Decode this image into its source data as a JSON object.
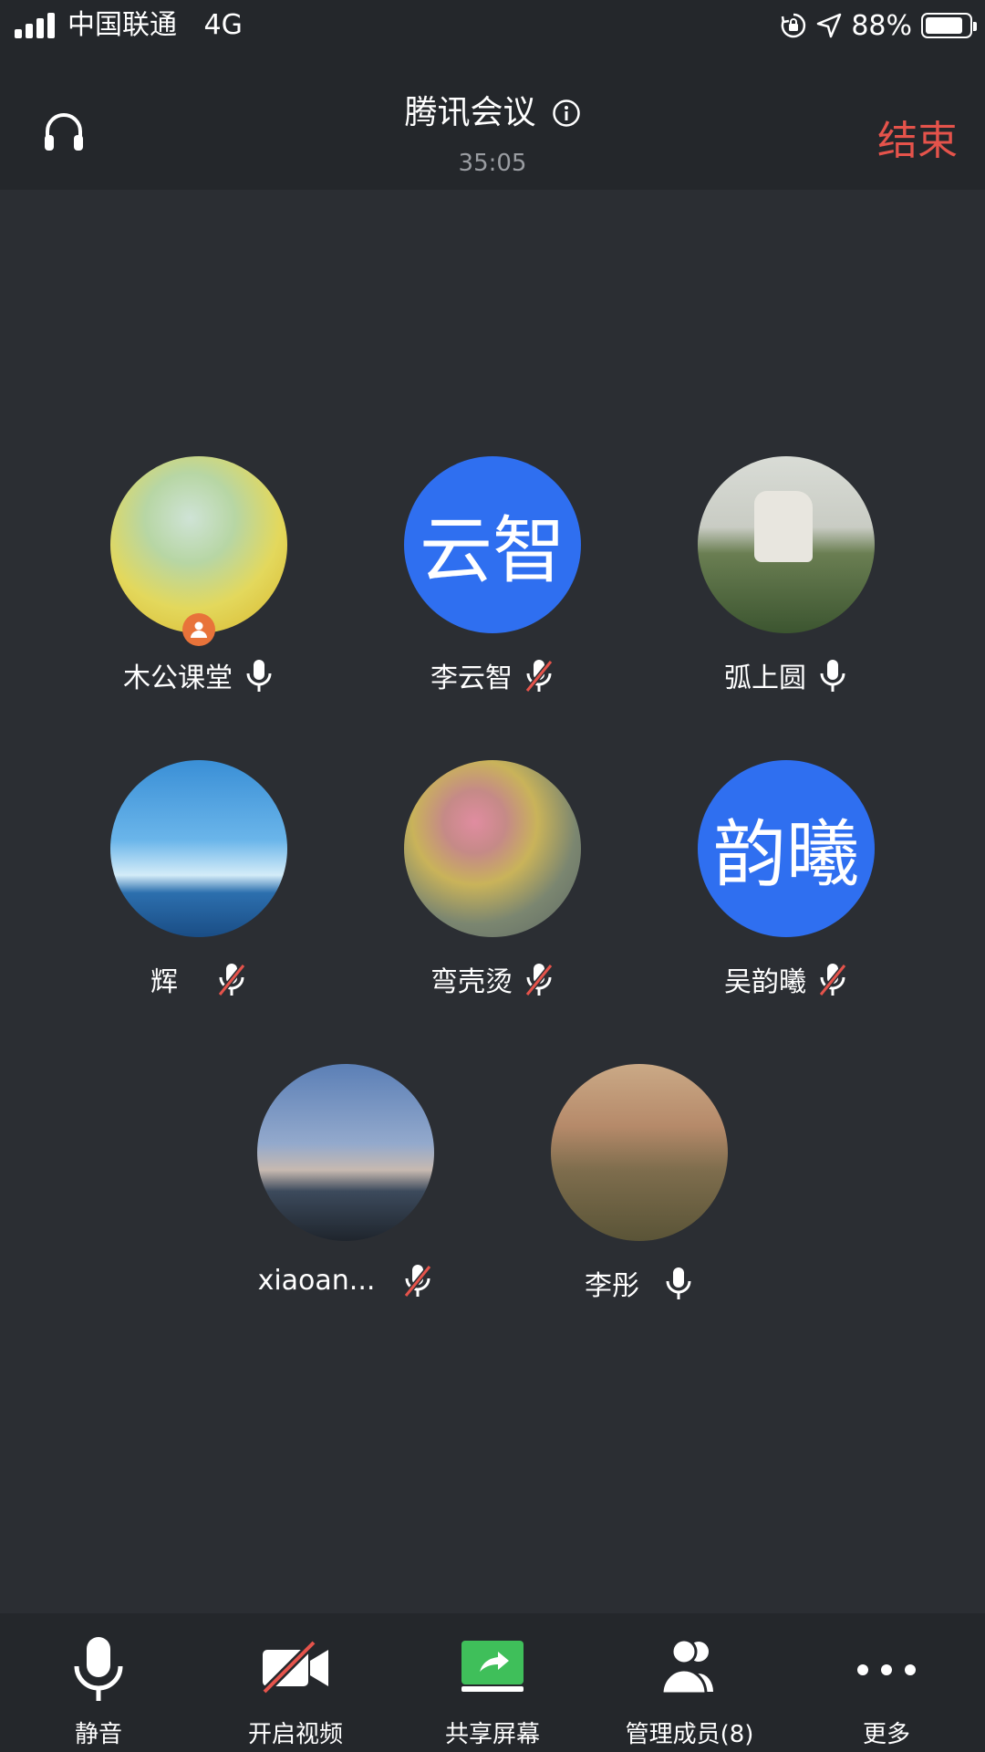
{
  "status_bar": {
    "carrier": "中国联通",
    "network": "4G",
    "battery_percent": "88%"
  },
  "header": {
    "title": "腾讯会议",
    "timer": "35:05",
    "end_label": "结束"
  },
  "participants": [
    {
      "name": "木公课堂",
      "mic": "on",
      "host": true,
      "avatar_text": ""
    },
    {
      "name": "李云智",
      "mic": "muted",
      "host": false,
      "avatar_text": "云智"
    },
    {
      "name": "弧上圆",
      "mic": "on",
      "host": false,
      "avatar_text": ""
    },
    {
      "name": "辉",
      "mic": "muted",
      "host": false,
      "avatar_text": ""
    },
    {
      "name": "弯壳烫",
      "mic": "muted",
      "host": false,
      "avatar_text": ""
    },
    {
      "name": "吴韵曦",
      "mic": "muted",
      "host": false,
      "avatar_text": "韵曦"
    },
    {
      "name": "xiaoan...",
      "mic": "muted",
      "host": false,
      "avatar_text": ""
    },
    {
      "name": "李彤",
      "mic": "on",
      "host": false,
      "avatar_text": ""
    }
  ],
  "toolbar": {
    "mute_label": "静音",
    "video_label": "开启视频",
    "share_label": "共享屏幕",
    "members_label": "管理成员(8)",
    "more_label": "更多"
  },
  "colors": {
    "background": "#2b2e33",
    "bar": "#24272b",
    "end_red": "#e5534b",
    "avatar_blue": "#2f6ff0",
    "host_orange": "#e8733a",
    "share_green": "#3fbf5a"
  }
}
